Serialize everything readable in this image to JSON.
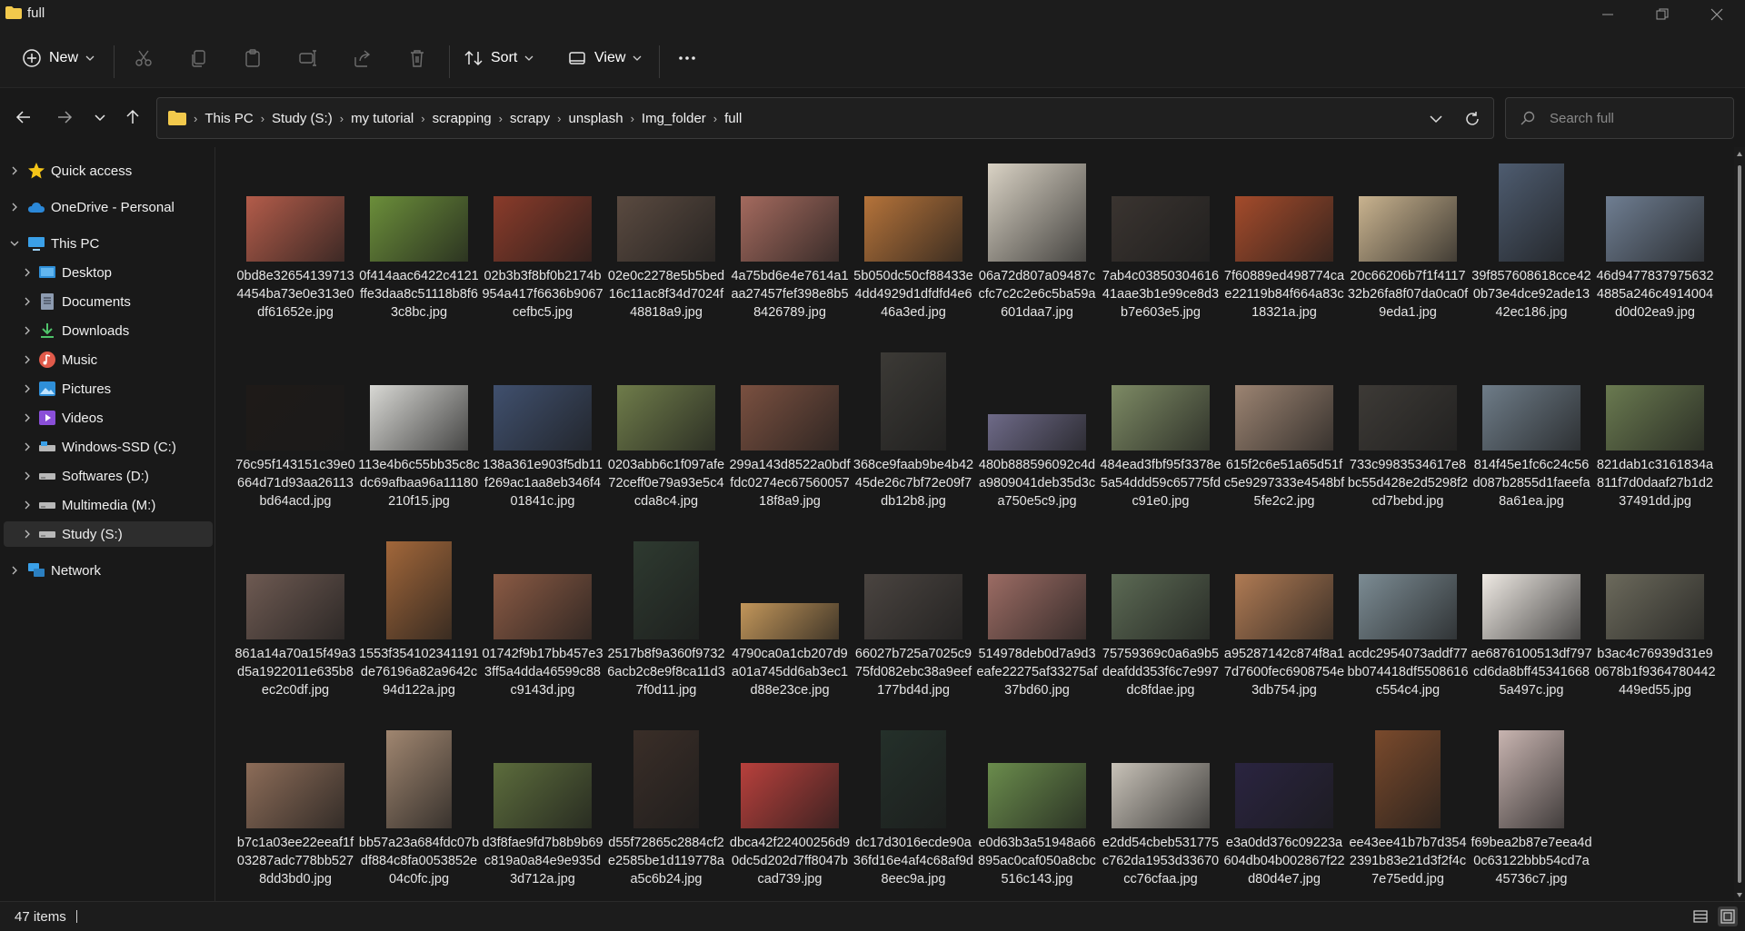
{
  "window": {
    "title": "full"
  },
  "toolbar": {
    "new_label": "New",
    "sort_label": "Sort",
    "view_label": "View"
  },
  "address": {
    "crumbs": [
      "This PC",
      "Study (S:)",
      "my tutorial",
      "scrapping",
      "scrapy",
      "unsplash",
      "Img_folder",
      "full"
    ]
  },
  "search": {
    "placeholder": "Search full"
  },
  "sidebar": {
    "items": [
      {
        "label": "Quick access",
        "icon": "star-icon"
      },
      {
        "label": "OneDrive - Personal",
        "icon": "cloud-icon"
      },
      {
        "label": "This PC",
        "icon": "monitor-icon"
      },
      {
        "label": "Desktop",
        "icon": "desktop-icon"
      },
      {
        "label": "Documents",
        "icon": "documents-icon"
      },
      {
        "label": "Downloads",
        "icon": "download-icon"
      },
      {
        "label": "Music",
        "icon": "music-icon"
      },
      {
        "label": "Pictures",
        "icon": "pictures-icon"
      },
      {
        "label": "Videos",
        "icon": "videos-icon"
      },
      {
        "label": "Windows-SSD (C:)",
        "icon": "drive-icon"
      },
      {
        "label": "Softwares (D:)",
        "icon": "drive-icon"
      },
      {
        "label": "Multimedia (M:)",
        "icon": "drive-icon"
      },
      {
        "label": "Study (S:)",
        "icon": "drive-icon"
      },
      {
        "label": "Network",
        "icon": "network-icon"
      }
    ]
  },
  "files": [
    "0bd8e326541397134454ba73e0e313e0df61652e.jpg",
    "0f414aac6422c4121ffe3daa8c51118b8f63c8bc.jpg",
    "02b3b3f8bf0b2174b954a417f6636b9067cefbc5.jpg",
    "02e0c2278e5b5bed16c11ac8f34d7024f48818a9.jpg",
    "4a75bd6e4e7614a1aa27457fef398e8b58426789.jpg",
    "5b050dc50cf88433e4dd4929d1dfdfd4e646a3ed.jpg",
    "06a72d807a09487ccfc7c2c2e6c5ba59a601daa7.jpg",
    "7ab4c0385030461641aae3b1e99ce8d3b7e603e5.jpg",
    "7f60889ed498774cae22119b84f664a83c18321a.jpg",
    "20c66206b7f1f411732b26fa8f07da0ca0f9eda1.jpg",
    "39f857608618cce420b73e4dce92ade1342ec186.jpg",
    "46d94778379756324885a246c4914004d0d02ea9.jpg",
    "76c95f143151c39e0664d71d93aa26113bd64acd.jpg",
    "113e4b6c55bb35c8cdc69afbaa96a11180210f15.jpg",
    "138a361e903f5db11f269ac1aa8eb346f401841c.jpg",
    "0203abb6c1f097afe72ceff0e79a93e5c4cda8c4.jpg",
    "299a143d8522a0bdffdc0274ec6756005718f8a9.jpg",
    "368ce9faab9be4b4245de26c7bf72e09f7db12b8.jpg",
    "480b888596092c4da9809041deb35d3ca750e5c9.jpg",
    "484ead3fbf95f3378e5a54ddd59c65775fdc91e0.jpg",
    "615f2c6e51a65d51fc5e9297333e4548bf5fe2c2.jpg",
    "733c9983534617e8bc55d428e2d5298f2cd7bebd.jpg",
    "814f45e1fc6c24c56d087b2855d1faeefa8a61ea.jpg",
    "821dab1c3161834a811f7d0daaf27b1d237491dd.jpg",
    "861a14a70a15f49a3d5a1922011e635b8ec2c0df.jpg",
    "1553f354102341191de76196a82a9642c94d122a.jpg",
    "01742f9b17bb457e33ff5a4dda46599c88c9143d.jpg",
    "2517b8f9a360f97326acb2c8e9f8ca11d37f0d11.jpg",
    "4790ca0a1cb207d9a01a745dd6ab3ec1d88e23ce.jpg",
    "66027b725a7025c975fd082ebc38a9eef177bd4d.jpg",
    "514978deb0d7a9d3eafe22275af33275af37bd60.jpg",
    "75759369c0a6a9b5deafdd353f6c7e997dc8fdae.jpg",
    "a95287142c874f8a17d7600fec6908754e3db754.jpg",
    "acdc2954073addf77bb074418df5508616c554c4.jpg",
    "ae6876100513df797cd6da8bff453416685a497c.jpg",
    "b3ac4c76939d31e90678b1f9364780442449ed55.jpg",
    "b7c1a03ee22eeaf1f03287adc778bb5278dd3bd0.jpg",
    "bb57a23a684fdc07bdf884c8fa0053852e04c0fc.jpg",
    "d3f8fae9fd7b8b9b69c819a0a84e9e935d3d712a.jpg",
    "d55f72865c2884cf2e2585be1d119778aa5c6b24.jpg",
    "dbca42f22400256d90dc5d202d7ff8047bcad739.jpg",
    "dc17d3016ecde90a36fd16e4af4c68af9d8eec9a.jpg",
    "e0d63b3a51948a66895ac0caf050a8cbc516c143.jpg",
    "e2dd54cbeb531775c762da1953d33670cc76cfaa.jpg",
    "e3a0dd376c09223a604db04b002867f22d80d4e7.jpg",
    "ee43ee41b7b7d3542391b83e21d3f2f4c7e75edd.jpg",
    "f69bea2b87e7eea4d0c63122bbb54cd7a45736c7.jpg"
  ],
  "status": {
    "count_text": "47 items"
  },
  "colors": {
    "accent": "#4cc2ff",
    "folder": "#f2c94c",
    "thumbs": [
      "#b35c4a",
      "#6b8e3a",
      "#8a3b2a",
      "#5a4a40",
      "#a46a5e",
      "#b5733a",
      "#d9d2c4",
      "#3a3430",
      "#a44b2b",
      "#c9b38f",
      "#4e5c70",
      "#6f7e92",
      "#1e1a18",
      "#d8d8d4",
      "#40506e",
      "#6f7c4a",
      "#7a5040",
      "#3c3a36",
      "#6e6a88",
      "#7d8a64",
      "#9c8472",
      "#3d3a36",
      "#6e7c88",
      "#6a7a50",
      "#6e5a52",
      "#a2673a",
      "#8a5a44",
      "#2e3a30",
      "#c2965a",
      "#4a4440",
      "#9c6c64",
      "#5c6a54",
      "#b07b54",
      "#7c8c94",
      "#efeae4",
      "#6c6a5c",
      "#8c6c58",
      "#a08670",
      "#5c6c3c",
      "#3a2e28",
      "#b8403c",
      "#24302a",
      "#6a8c4c",
      "#c8c2b8",
      "#2a2440",
      "#7a4a2c",
      "#c8b4b0"
    ]
  }
}
